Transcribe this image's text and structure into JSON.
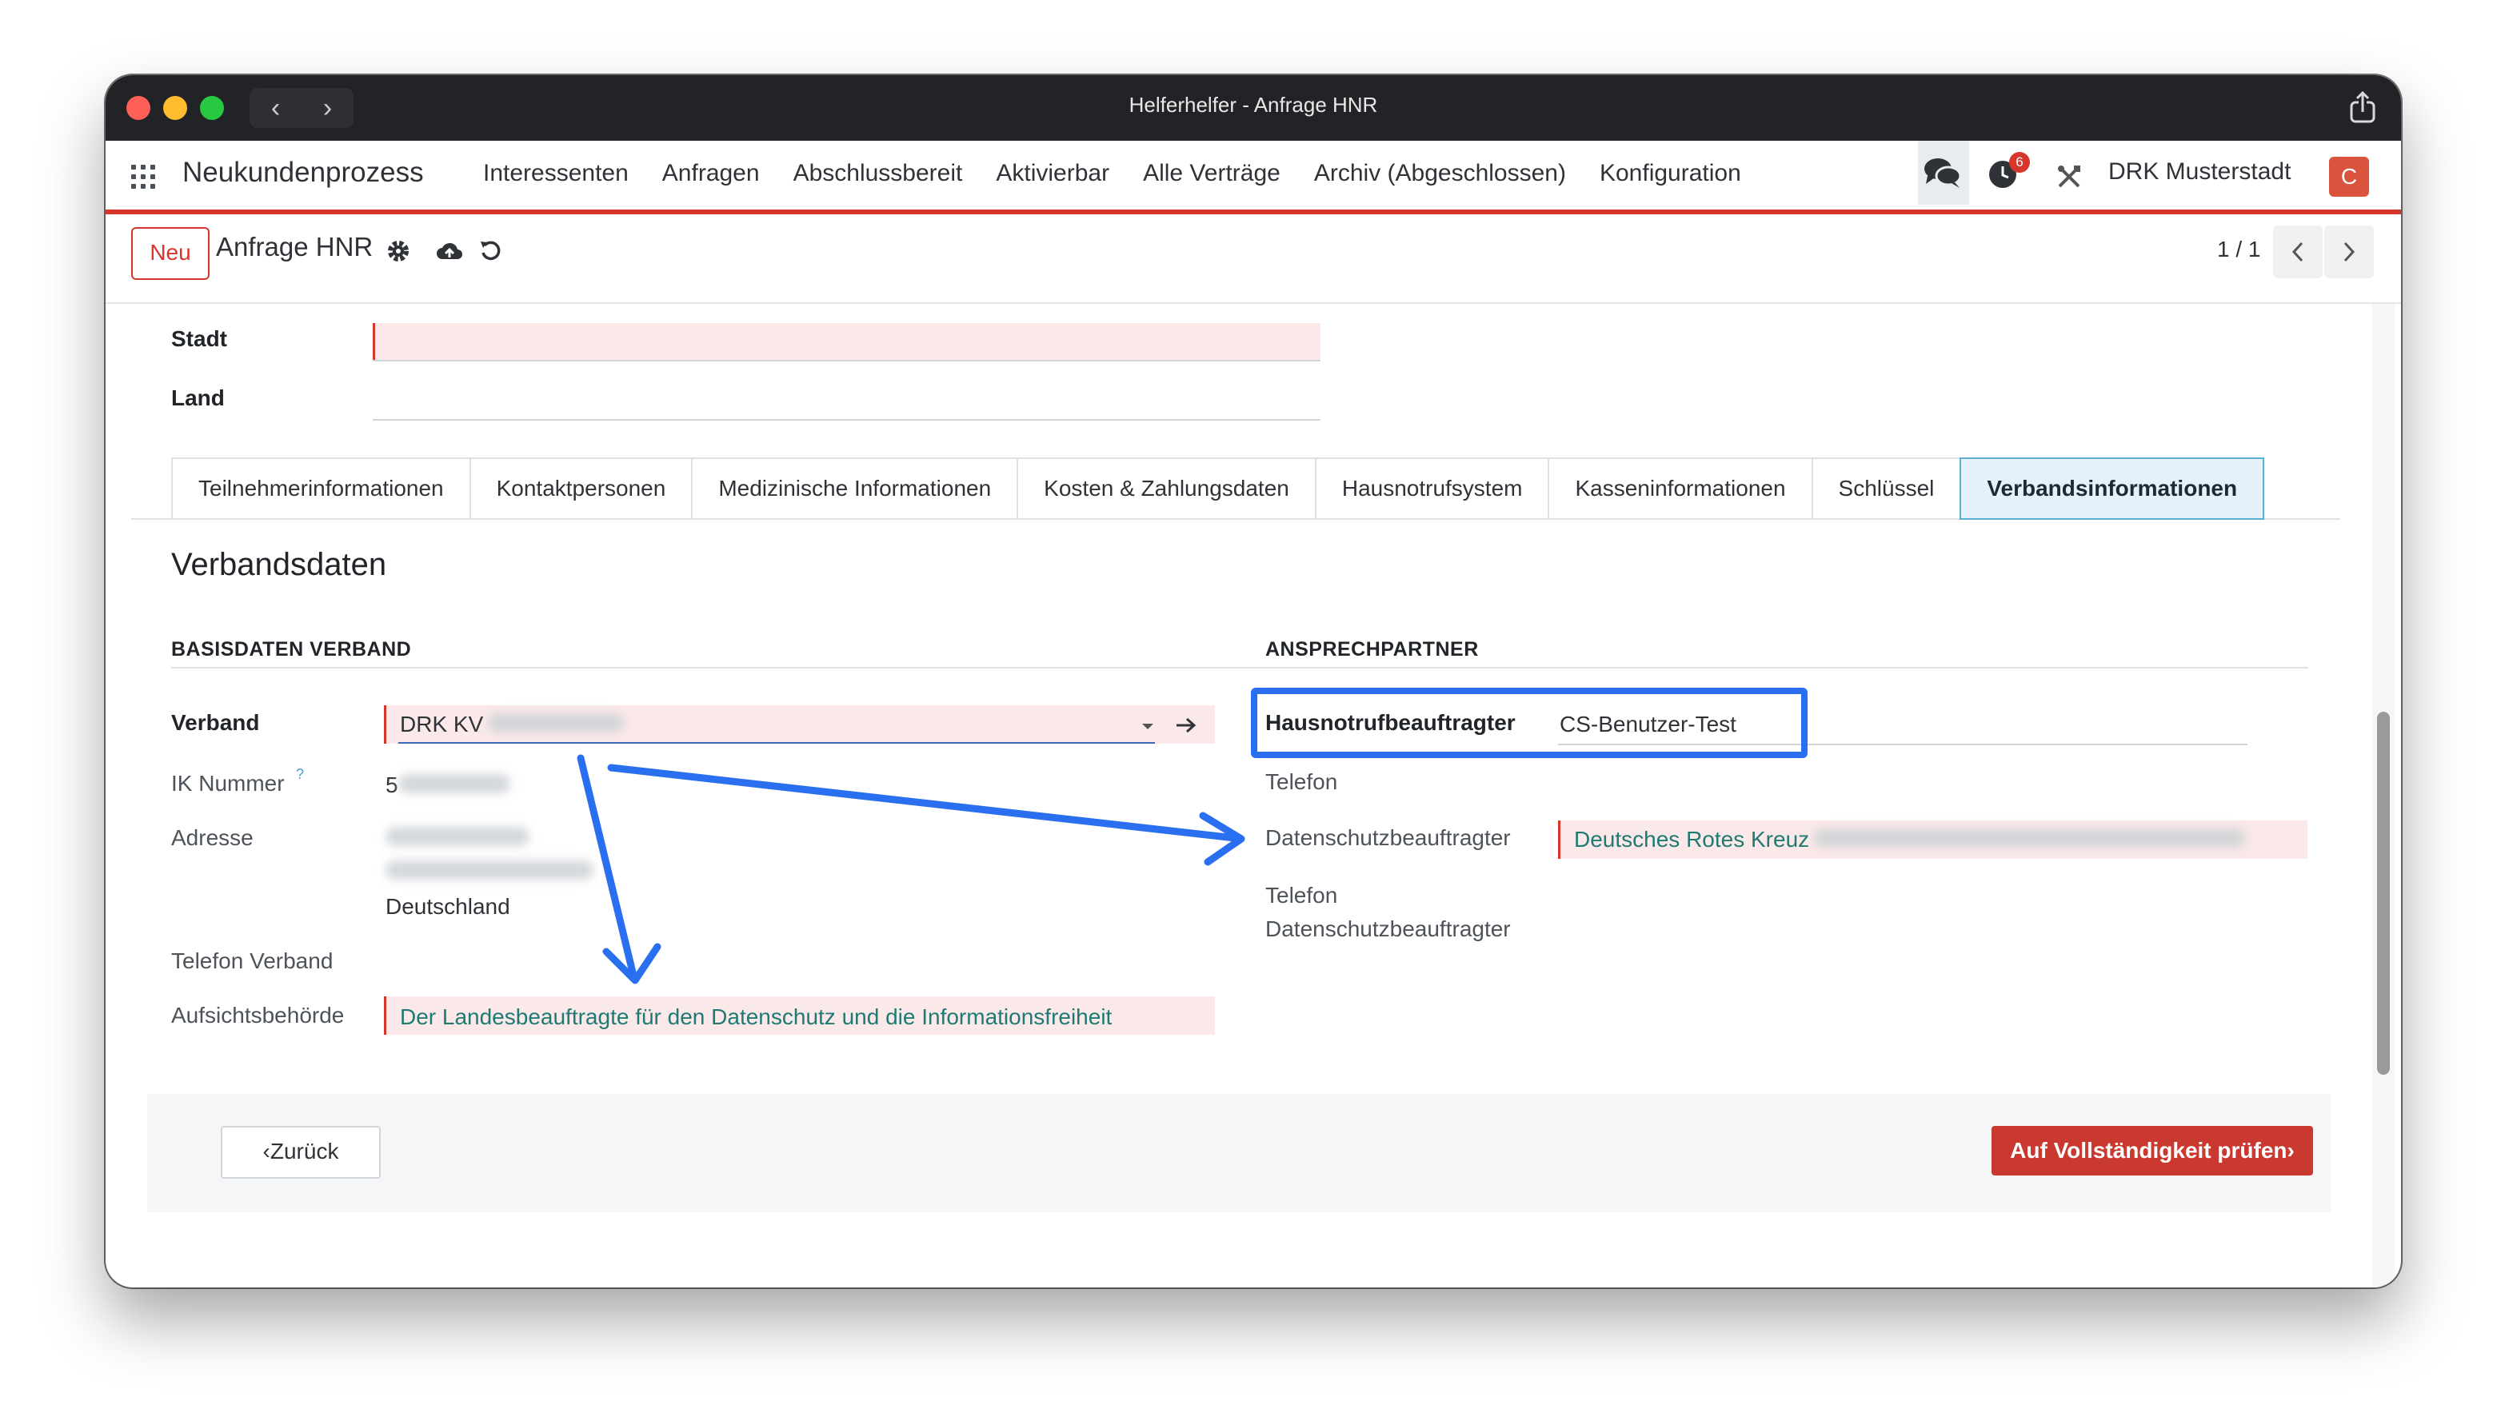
{
  "window": {
    "title": "Helferhelfer - Anfrage HNR"
  },
  "menubar": {
    "brand": "Neukundenprozess",
    "items": [
      "Interessenten",
      "Anfragen",
      "Abschlussbereit",
      "Aktivierbar",
      "Alle Verträge",
      "Archiv (Abgeschlossen)",
      "Konfiguration"
    ],
    "activity_count": "6",
    "company": "DRK Musterstadt",
    "avatar_initial": "C",
    "accent_color": "#d6362b"
  },
  "control": {
    "new_button": "Neu",
    "record_title": "Anfrage HNR",
    "pager": "1 / 1"
  },
  "address": {
    "stadt_label": "Stadt",
    "land_label": "Land"
  },
  "tabs": [
    {
      "label": "Teilnehmerinformationen",
      "active": false
    },
    {
      "label": "Kontaktpersonen",
      "active": false
    },
    {
      "label": "Medizinische Informationen",
      "active": false
    },
    {
      "label": "Kosten & Zahlungsdaten",
      "active": false
    },
    {
      "label": "Hausnotrufsystem",
      "active": false
    },
    {
      "label": "Kasseninformationen",
      "active": false
    },
    {
      "label": "Schlüssel",
      "active": false
    },
    {
      "label": "Verbandsinformationen",
      "active": true
    }
  ],
  "section": {
    "title": "Verbandsdaten"
  },
  "basisdaten": {
    "title": "BASISDATEN VERBAND",
    "verband_label": "Verband",
    "verband_value": "DRK KV",
    "ik_label": "IK Nummer",
    "ik_help": "?",
    "ik_value_prefix": "5",
    "adresse_label": "Adresse",
    "adresse_country": "Deutschland",
    "telefon_label": "Telefon Verband",
    "aufsicht_label": "Aufsichtsbehörde",
    "aufsicht_value": "Der Landesbeauftragte für den Datenschutz und die Informationsfreiheit"
  },
  "ansprechpartner": {
    "title": "ANSPRECHPARTNER",
    "hnr_label": "Hausnotrufbeauftragter",
    "hnr_value": "CS-Benutzer-Test",
    "telefon_label": "Telefon",
    "ds_label": "Datenschutzbeauftragter",
    "ds_value": "Deutsches Rotes Kreuz",
    "ds_telefon_label_1": "Telefon",
    "ds_telefon_label_2": "Datenschutzbeauftragter"
  },
  "footer": {
    "back_button": "‹Zurück",
    "check_button": "Auf Vollständigkeit prüfen›"
  },
  "annotation_color": "#2a6ff0"
}
